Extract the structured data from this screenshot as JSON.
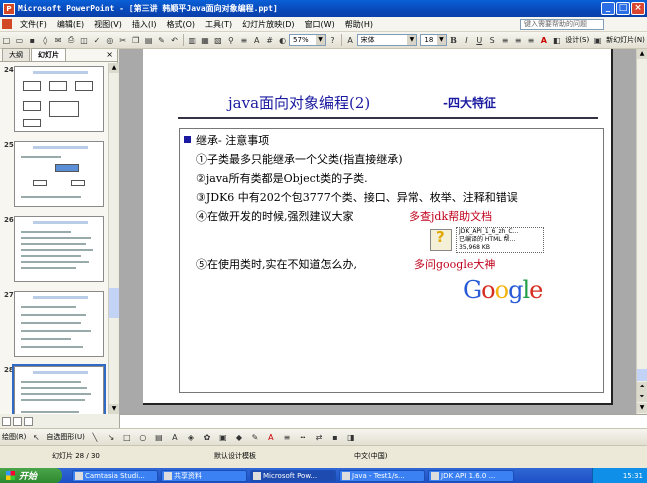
{
  "window": {
    "title": "Microsoft PowerPoint - [第三讲 韩顺平Java面向对象编程.ppt]",
    "icon": "powerpoint-icon"
  },
  "menu": {
    "items": [
      "文件(F)",
      "编辑(E)",
      "视图(V)",
      "插入(I)",
      "格式(O)",
      "工具(T)",
      "幻灯片放映(D)",
      "窗口(W)",
      "帮助(H)"
    ],
    "help_placeholder": "键入需要帮助的问题"
  },
  "toolbar": {
    "zoom": "57%",
    "font": "宋体",
    "font_size": "18",
    "bold": "B",
    "italic": "I",
    "underline": "U",
    "design_label": "设计(S)",
    "new_slide_label": "新幻灯片(N)"
  },
  "left_panel": {
    "tabs": [
      "大纲",
      "幻灯片"
    ],
    "active_tab": "幻灯片",
    "thumbnails": [
      {
        "num": "24",
        "selected": false
      },
      {
        "num": "25",
        "selected": false
      },
      {
        "num": "26",
        "selected": false
      },
      {
        "num": "27",
        "selected": false
      },
      {
        "num": "28",
        "selected": true
      }
    ]
  },
  "slide": {
    "title": "java面向对象编程(2)",
    "subtitle": "-四大特征",
    "heading": "继承- 注意事项",
    "lines": [
      "①子类最多只能继承一个父类(指直接继承)",
      "②java所有类都是Object类的子类.",
      "③JDK6 中有202个包3777个类、接口、异常、枚举、注释和错误",
      "④在做开发的时候,强烈建议大家",
      "多查jdk帮助文档",
      "⑤在使用类时,实在不知道怎么办,",
      "多问google大神"
    ],
    "jdk_file": {
      "name": "JDK_API_1_6_zh_C...",
      "type": "已编译的 HTML 帮...",
      "size": "35,968 KB"
    },
    "google_logo": "Google"
  },
  "notes": {
    "placeholder": ""
  },
  "drawbar": {
    "draw_label": "绘图(R)",
    "autoshape_label": "自选图形(U)"
  },
  "status": {
    "slide_pos": "幻灯片 28 / 30",
    "design": "默认设计模板",
    "language": "中文(中国)"
  },
  "taskbar": {
    "start": "开始",
    "tasks": [
      "Camtasia Studi...",
      "共享资料",
      "Microsoft Pow...",
      "Java - Test1/s...",
      "JDK API 1.6.0 ..."
    ],
    "active_task": "Microsoft Pow...",
    "time": "15:31"
  },
  "colors": {
    "title_blue": "#1a1aa0",
    "highlight_red": "#c0001a",
    "titlebar_blue": "#0a5fd8"
  }
}
